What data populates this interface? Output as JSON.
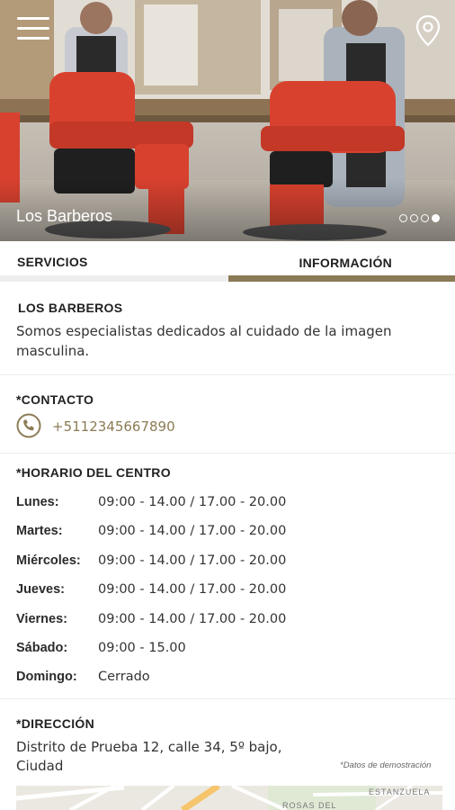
{
  "hero": {
    "title": "Los Barberos",
    "slides": 4,
    "active_slide": 4
  },
  "tabs": [
    {
      "label": "SERVICIOS",
      "active": false
    },
    {
      "label": "INFORMACIÓN",
      "active": true
    }
  ],
  "about": {
    "heading": "LOS BARBEROS",
    "description_line1": "Somos especialistas dedicados al cuidado de la imagen",
    "description_line2": "masculina."
  },
  "contact": {
    "heading": "*CONTACTO",
    "phone": "+5112345667890"
  },
  "schedule": {
    "heading": "*HORARIO DEL CENTRO",
    "days": [
      {
        "day": "Lunes:",
        "hours": "09:00 - 14.00  /  17.00 - 20.00"
      },
      {
        "day": "Martes:",
        "hours": "09:00 - 14.00  /  17.00 - 20.00"
      },
      {
        "day": "Miércoles:",
        "hours": "09:00 - 14.00  /  17.00 - 20.00"
      },
      {
        "day": "Jueves:",
        "hours": "09:00 - 14.00  /  17.00 - 20.00"
      },
      {
        "day": "Viernes:",
        "hours": "09:00 - 14.00  /  17.00 - 20.00"
      },
      {
        "day": "Sábado:",
        "hours": "09:00 - 15.00"
      },
      {
        "day": "Domingo:",
        "hours": "Cerrado"
      }
    ]
  },
  "address": {
    "heading": "*DIRECCIÓN",
    "line1": "Distrito de Prueba 12, calle 34, 5º bajo,",
    "line2": "Ciudad",
    "demo_note": "*Datos de demostración"
  },
  "map": {
    "label_1": "ESTANZUELA",
    "label_2": "ROSAS DEL"
  },
  "colors": {
    "accent": "#8a7a55",
    "accent_text": "#8c7c55",
    "chair_red": "#d9412f"
  },
  "icons": {
    "menu": "hamburger-icon",
    "location": "map-pin-icon",
    "phone": "phone-icon"
  }
}
